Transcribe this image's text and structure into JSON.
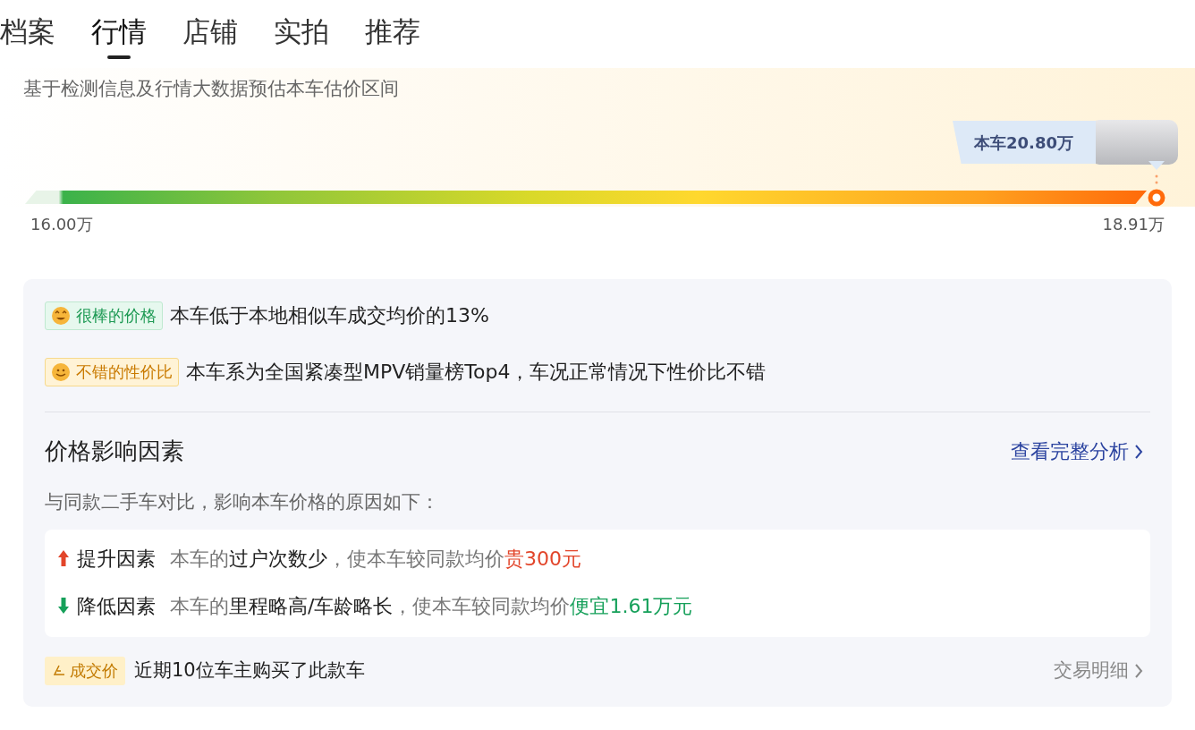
{
  "tabs": [
    {
      "label": "档案",
      "selected": false
    },
    {
      "label": "行情",
      "selected": true
    },
    {
      "label": "店铺",
      "selected": false
    },
    {
      "label": "实拍",
      "selected": false
    },
    {
      "label": "推荐",
      "selected": false
    }
  ],
  "estimate": {
    "subtitle": "基于检测信息及行情大数据预估本车估价区间",
    "car_price": "本车20.80万",
    "range_min": "16.00万",
    "range_max": "18.91万"
  },
  "tags": [
    {
      "kind": "great",
      "label": "很棒的价格",
      "text": "本车低于本地相似车成交均价的13%"
    },
    {
      "kind": "good",
      "label": "不错的性价比",
      "text": "本车系为全国紧凑型MPV销量榜Top4，车况正常情况下性价比不错"
    }
  ],
  "factors": {
    "title": "价格影响因素",
    "link": "查看完整分析",
    "intro": "与同款二手车对比，影响本车价格的原因如下：",
    "items": [
      {
        "kind": "up",
        "label": "提升因素",
        "segments": [
          {
            "text": "本车的",
            "color": "#777777"
          },
          {
            "text": "过户次数少",
            "color": "#222222"
          },
          {
            "text": "，使本车较同款均价",
            "color": "#777777"
          },
          {
            "text": "贵300元",
            "color": "#e2452a"
          }
        ]
      },
      {
        "kind": "down",
        "label": "降低因素",
        "segments": [
          {
            "text": "本车的",
            "color": "#777777"
          },
          {
            "text": "里程略高/车龄略长",
            "color": "#222222"
          },
          {
            "text": "，使本车较同款均价",
            "color": "#777777"
          },
          {
            "text": "便宜1.61万元",
            "color": "#16a05a"
          }
        ]
      }
    ]
  },
  "deals": {
    "badge": "成交价",
    "text": "近期10位车主购买了此款车",
    "link": "交易明细"
  }
}
